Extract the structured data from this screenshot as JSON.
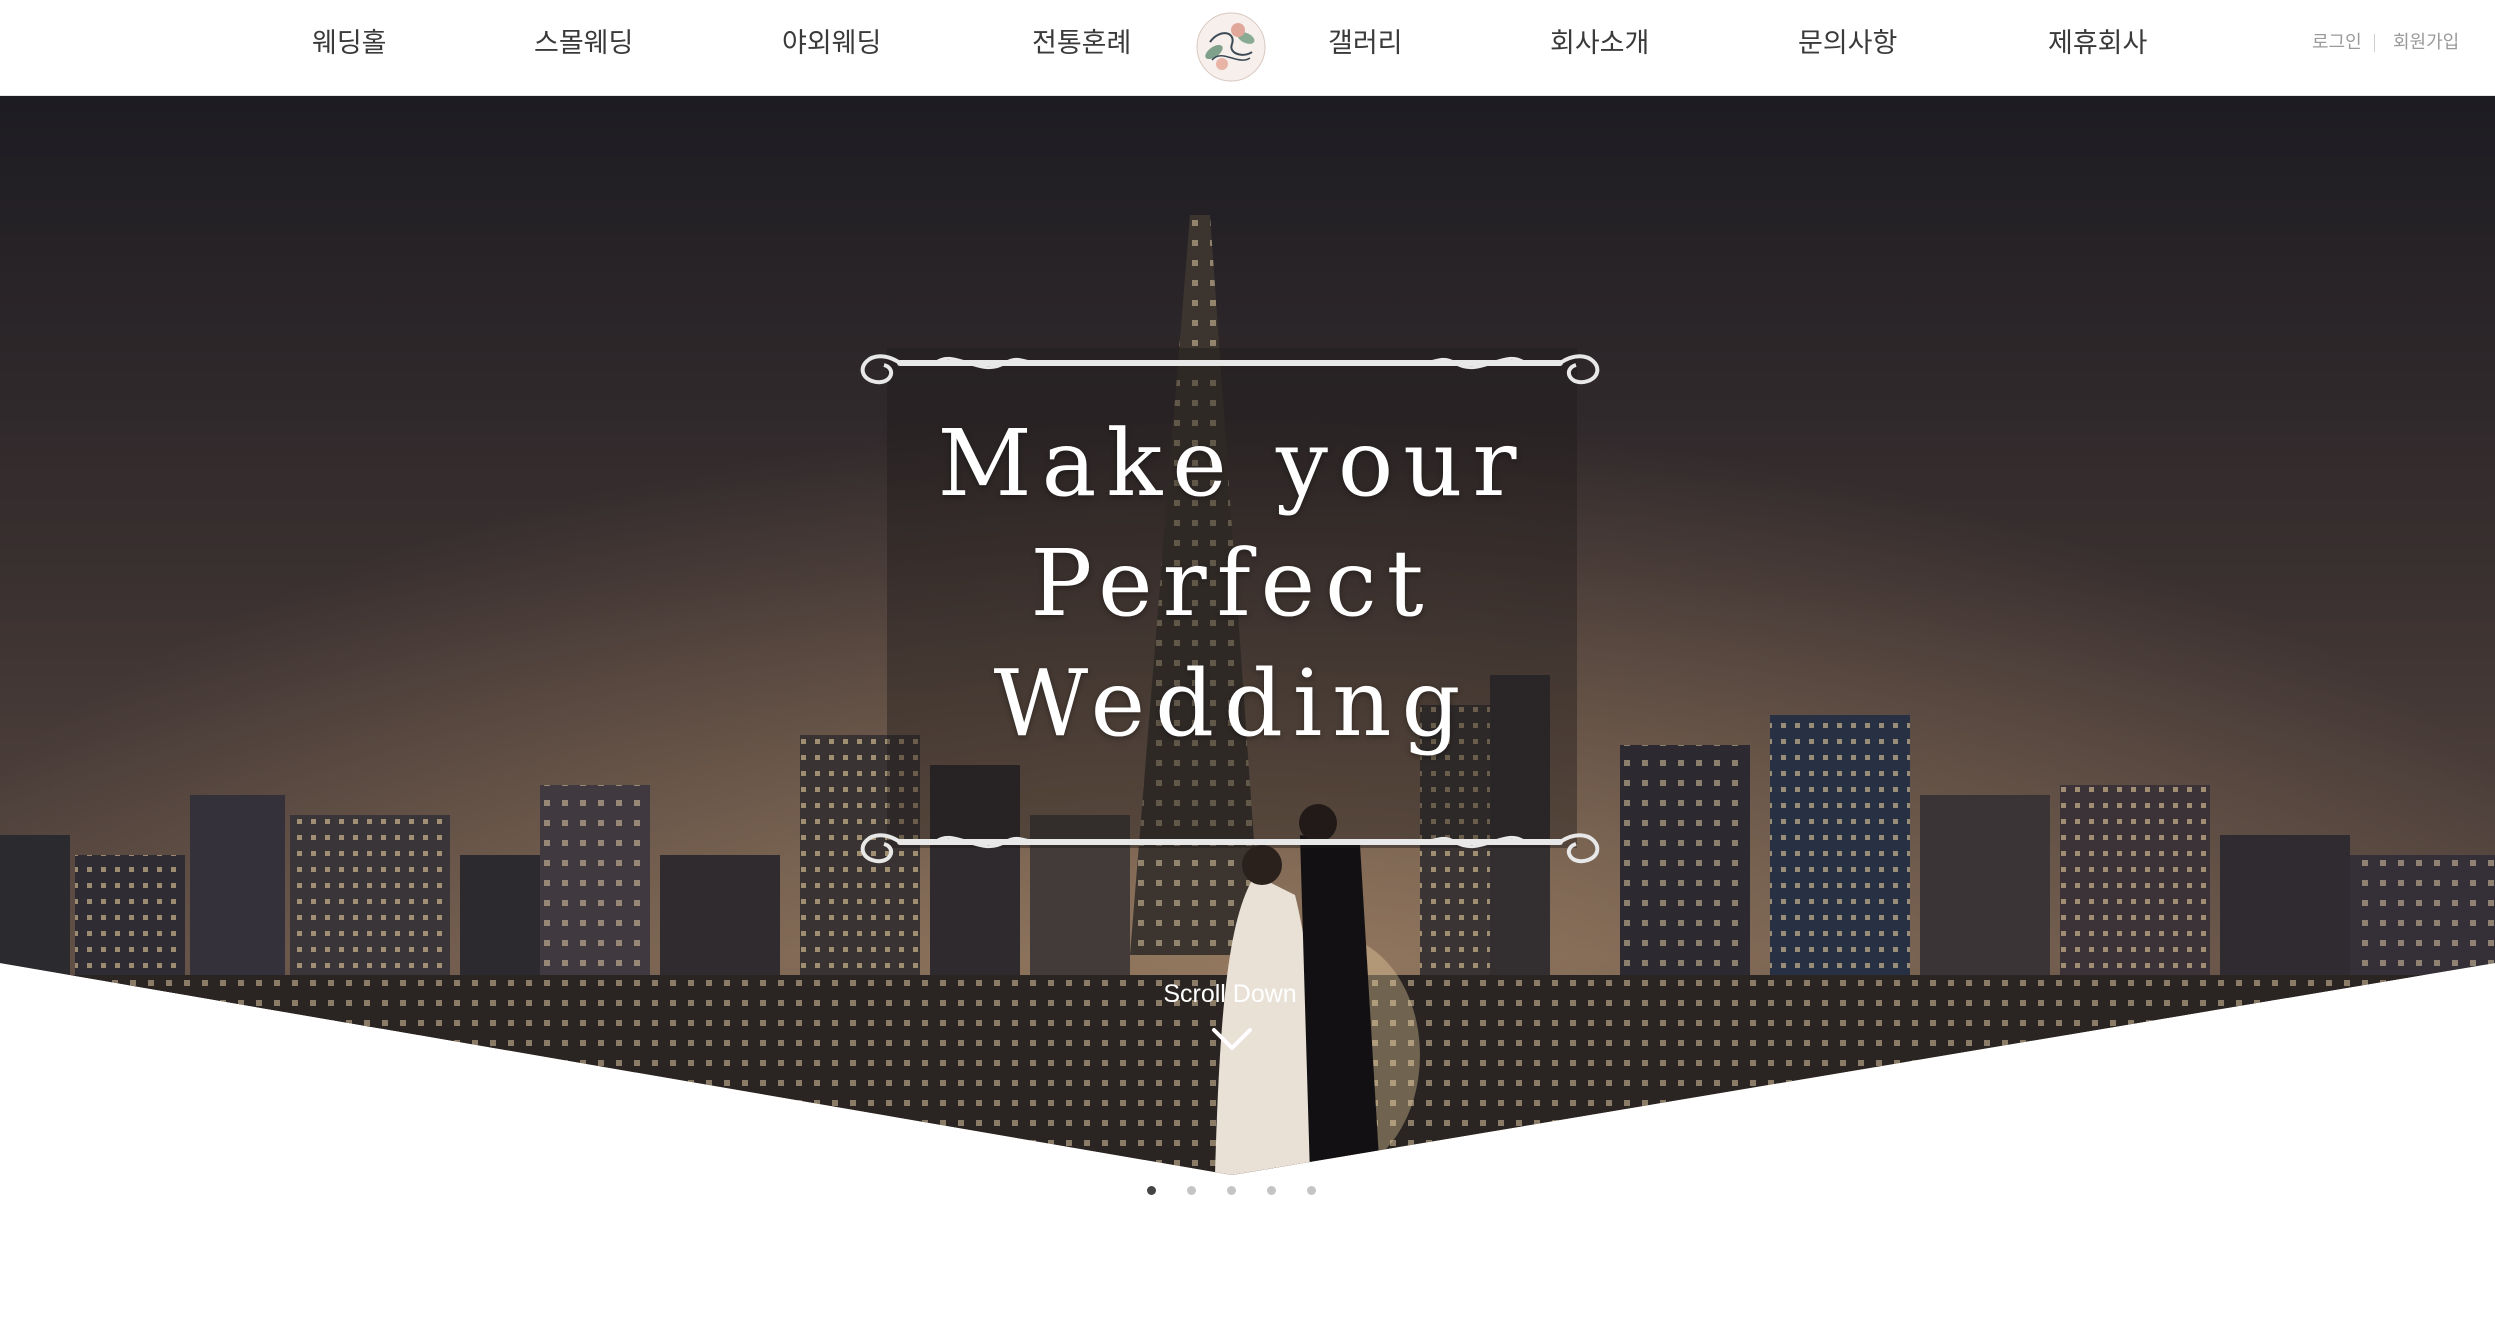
{
  "nav": {
    "items": [
      {
        "label": "웨딩홀"
      },
      {
        "label": "스몰웨딩"
      },
      {
        "label": "야외웨딩"
      },
      {
        "label": "전통혼례"
      },
      {
        "label": "갤러리"
      },
      {
        "label": "회사소개"
      },
      {
        "label": "문의사항"
      },
      {
        "label": "제휴회사"
      }
    ],
    "logo_icon": "wedding-logo-icon",
    "login_label": "로그인",
    "signup_label": "회원가입"
  },
  "hero": {
    "headline_lines": [
      "Make your",
      "Perfect",
      "Wedding"
    ],
    "scroll_label": "Scroll Down",
    "scroll_icon": "chevron-down-icon",
    "slide_count": 5,
    "active_slide": 1
  },
  "colors": {
    "nav_text": "#3a3a3a",
    "auth_text": "#9a9a9a",
    "headline_text": "#ffffff",
    "dot_active": "#444444",
    "dot_inactive": "#c4c4c4"
  }
}
